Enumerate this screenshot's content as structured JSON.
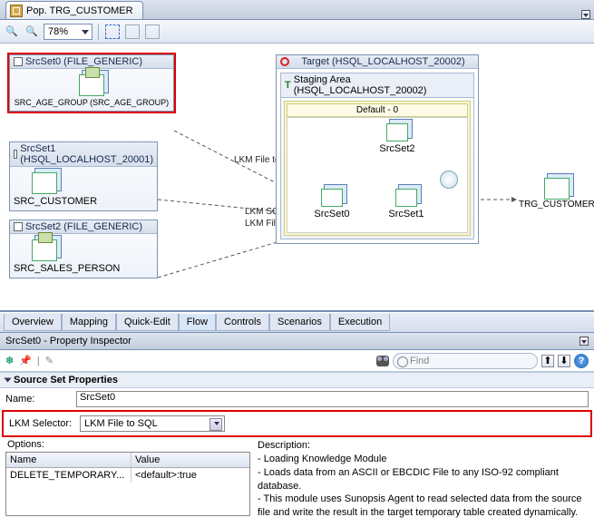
{
  "tab": {
    "title": "Pop. TRG_CUSTOMER"
  },
  "toolbar": {
    "zoom": "78%"
  },
  "canvas": {
    "block0": {
      "header": "SrcSet0 (FILE_GENERIC)",
      "label": "SRC_AGE_GROUP (SRC_AGE_GROUP)"
    },
    "block1": {
      "header": "SrcSet1 (HSQL_LOCALHOST_20001)",
      "label": "SRC_CUSTOMER"
    },
    "block2": {
      "header": "SrcSet2 (FILE_GENERIC)",
      "label": "SRC_SALES_PERSON"
    },
    "target": {
      "header": "Target (HSQL_LOCALHOST_20002)",
      "staging_header": "Staging Area (HSQL_LOCALHOST_20002)",
      "default_header": "Default - 0",
      "srcset0": "SrcSet0",
      "srcset1": "SrcSet1",
      "srcset2": "SrcSet2"
    },
    "trg_label": "TRG_CUSTOMER",
    "link_labels": {
      "file": "LKM File to SQL",
      "sql1": "LKM SQL to SQL",
      "sql2": "LKM File to SQL"
    }
  },
  "bottom_tabs": [
    "Overview",
    "Mapping",
    "Quick-Edit",
    "Flow",
    "Controls",
    "Scenarios",
    "Execution"
  ],
  "inspector": {
    "title": "SrcSet0 - Property Inspector",
    "section": "Source Set Properties",
    "name_label": "Name:",
    "name_value": "SrcSet0",
    "lkm_label": "LKM Selector:",
    "lkm_value": "LKM File to SQL",
    "options_label": "Options:",
    "options": {
      "col_name": "Name",
      "col_value": "Value",
      "row_name": "DELETE_TEMPORARY...",
      "row_value": "<default>:true"
    },
    "desc_label": "Description:",
    "desc_line1": "- Loading Knowledge Module",
    "desc_line2": "- Loads data from an ASCII or EBCDIC File to any ISO-92 compliant database.",
    "desc_line3": "- This module uses Sunopsis Agent to read selected data from the source file and write the result in the target temporary table created dynamically.",
    "find_placeholder": "Find"
  }
}
